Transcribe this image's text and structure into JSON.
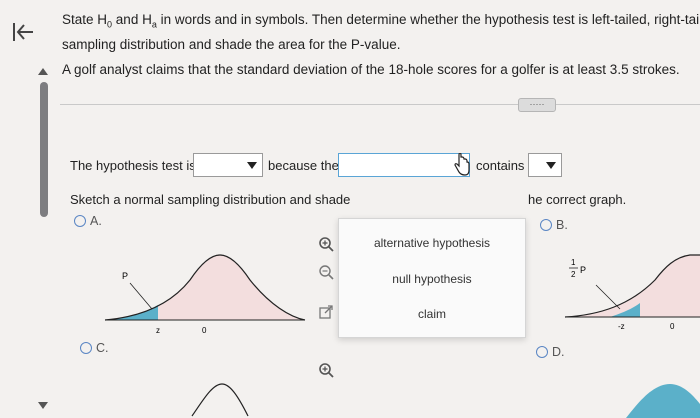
{
  "question": {
    "line1_pre": "State H",
    "h0_sub": "0",
    "line1_mid": " and H",
    "ha_sub": "a",
    "line1_post": " in words and in symbols. Then determine whether the hypothesis test is left-tailed, right-tailed,",
    "line2": "sampling distribution and shade the area for the P-value.",
    "problem": "A golf analyst claims that the standard deviation of the 18-hole scores for a golfer is at least 3.5 strokes."
  },
  "more_button": "·····",
  "statement": {
    "prefix": "The hypothesis test is",
    "middle": "because the",
    "contains": "contains",
    "dropdown1_value": "",
    "dropdown2_value": "",
    "dropdown3_value": ""
  },
  "sketch_instruction_left": "Sketch a normal sampling distribution and shade",
  "sketch_instruction_right": "he correct graph.",
  "dropdown_options": [
    "alternative hypothesis",
    "null hypothesis",
    "claim"
  ],
  "choices": {
    "a": "A.",
    "b": "B.",
    "c": "C.",
    "d": "D."
  },
  "graph_labels": {
    "a_p": "P",
    "a_z": "z",
    "a_zero": "0",
    "b_half_num": "1",
    "b_half_den": "2",
    "b_p": "P",
    "b_negz": "-z",
    "b_zero": "0"
  },
  "colors": {
    "shade": "#5bb0c9",
    "curve_fill": "#f3dede",
    "curve_line": "#222222",
    "radio": "#5a86c4",
    "dropdown_focus": "#5aa5d6"
  },
  "icons": [
    "back-arrow-icon",
    "zoom-in-icon",
    "zoom-out-icon",
    "external-link-icon",
    "hand-cursor-icon"
  ]
}
